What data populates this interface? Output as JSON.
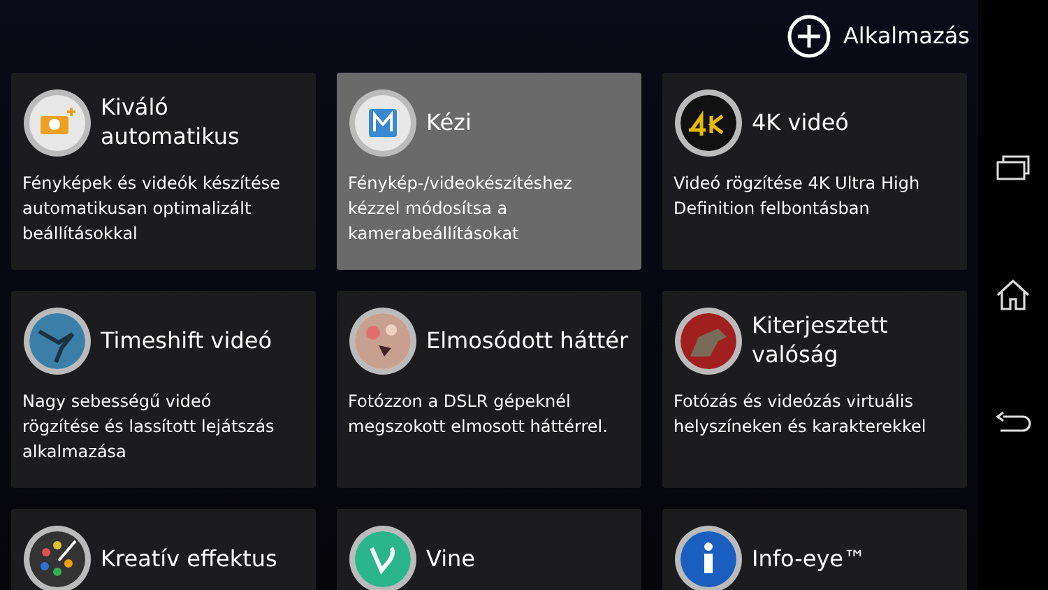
{
  "add_button": {
    "label": "Alkalmazás"
  },
  "modes": [
    {
      "kind": "auto",
      "title": "Kiváló automatikus",
      "description": "Fényképek és videók készítése automatikusan optimalizált beállításokkal",
      "selected": false
    },
    {
      "kind": "manual",
      "title": "Kézi",
      "description": "Fénykép-/videokészítéshez kézzel módosítsa a kamerabeállításokat",
      "selected": true
    },
    {
      "kind": "uhd",
      "title": "4K videó",
      "description": "Videó rögzítése 4K Ultra High Definition felbontásban",
      "selected": false
    },
    {
      "kind": "timeshift",
      "title": "Timeshift videó",
      "description": "Nagy sebességű videó rögzítése és lassított lejátszás alkalmazása",
      "selected": false
    },
    {
      "kind": "bokeh",
      "title": "Elmosódott háttér",
      "description": "Fotózzon a DSLR gépeknél megszokott elmosott háttérrel.",
      "selected": false
    },
    {
      "kind": "ar",
      "title": "Kiterjesztett valóság",
      "description": "Fotózás és videózás virtuális helyszíneken és karakterekkel",
      "selected": false
    },
    {
      "kind": "creative",
      "title": "Kreatív effektus",
      "selected": false
    },
    {
      "kind": "vine",
      "title": "Vine",
      "selected": false
    },
    {
      "kind": "info",
      "title": "Info-eye™",
      "selected": false
    }
  ]
}
